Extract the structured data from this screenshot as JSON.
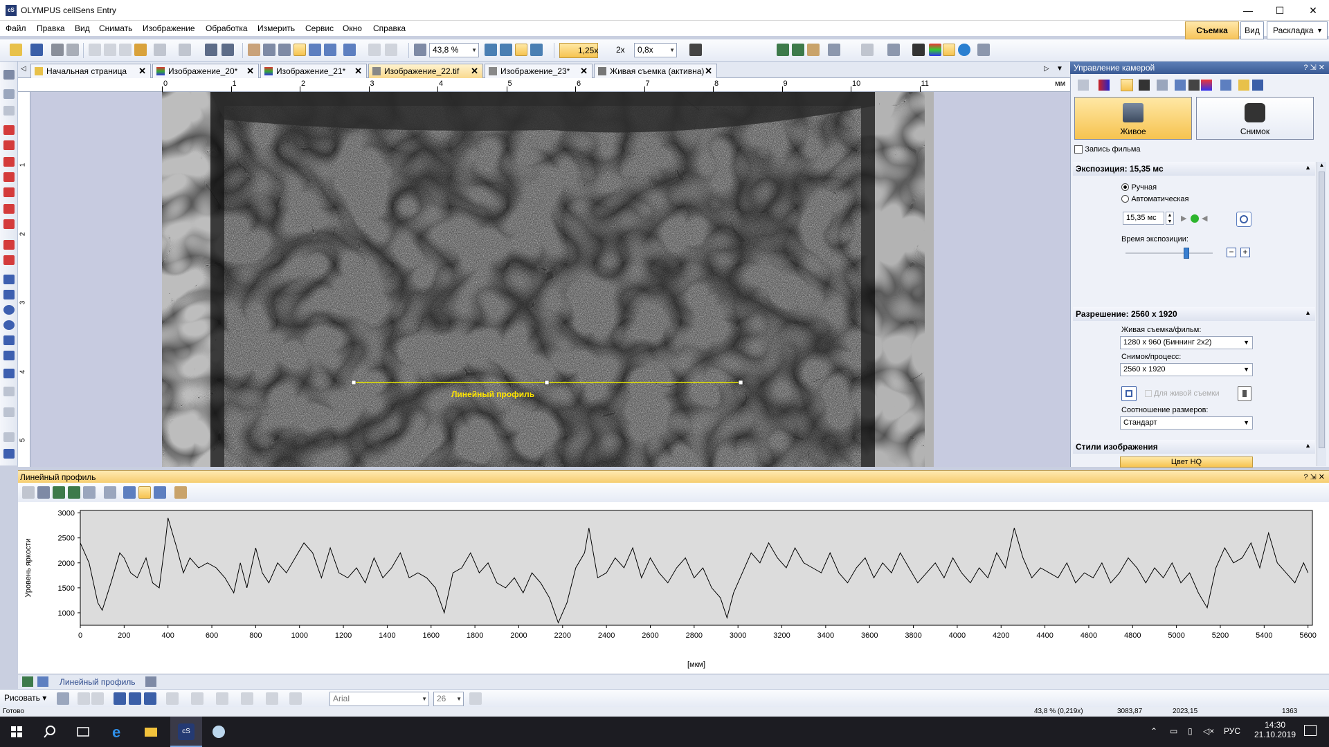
{
  "window": {
    "title": "OLYMPUS cellSens Entry",
    "min": "—",
    "max": "☐",
    "close": "✕",
    "app_icon": "cS"
  },
  "menu": [
    "Файл",
    "Правка",
    "Вид",
    "Снимать",
    "Изображение",
    "Обработка",
    "Измерить",
    "Сервис",
    "Окно",
    "Справка"
  ],
  "ribbon_tabs": {
    "capture": "Съемка",
    "view": "Вид",
    "layout": "Раскладка"
  },
  "toolbar": {
    "zoom": "43,8 %",
    "mag1": "1,25x",
    "mag2": "2x",
    "mag3": "0,8x"
  },
  "doc_tabs": [
    {
      "label": "Начальная страница",
      "active": false
    },
    {
      "label": "Изображение_20*",
      "active": false
    },
    {
      "label": "Изображение_21*",
      "active": false
    },
    {
      "label": "Изображение_22.tif",
      "active": true
    },
    {
      "label": "Изображение_23*",
      "active": false
    },
    {
      "label": "Живая съемка (активна)",
      "active": false
    }
  ],
  "ruler": {
    "unit": "мм",
    "ticks": [
      "0",
      "1",
      "2",
      "3",
      "4",
      "5",
      "6",
      "7",
      "8",
      "9",
      "10",
      "11"
    ],
    "vticks": [
      "1",
      "2",
      "3",
      "4",
      "5"
    ]
  },
  "image": {
    "profile_label": "Линейный профиль"
  },
  "camera_panel": {
    "title": "Управление камерой",
    "live_btn": "Живое",
    "snap_btn": "Снимок",
    "record_movie": "Запись фильма",
    "exposure_header": "Экспозиция: 15,35 мс",
    "mode_manual": "Ручная",
    "mode_auto": "Автоматическая",
    "exposure_value": "15,35 мс",
    "exposure_time_label": "Время экспозиции:",
    "exposure_slider_level": 0.7,
    "resolution_header": "Разрешение: 2560 x 1920",
    "live_label": "Живая съемка/фильм:",
    "live_value": "1280 x 960 (Биннинг 2x2)",
    "snap_label": "Снимок/процесс:",
    "snap_value": "2560 x 1920",
    "for_live": "Для живой съемки",
    "aspect_label": "Соотношение размеров:",
    "aspect_value": "Стандарт",
    "styles_header": "Стили изображения",
    "style_btn": "Цвет HQ"
  },
  "line_profile": {
    "title": "Линейный профиль",
    "ctrl": "? ⇲ ✕"
  },
  "chart_data": {
    "type": "line",
    "title": "",
    "xlabel": "[мкм]",
    "ylabel": "Уровень яркости",
    "xlim": [
      0,
      5620
    ],
    "ylim": [
      750,
      3050
    ],
    "x_ticks": [
      0,
      200,
      400,
      600,
      800,
      1000,
      1200,
      1400,
      1600,
      1800,
      2000,
      2200,
      2400,
      2600,
      2800,
      3000,
      3200,
      3400,
      3600,
      3800,
      4000,
      4200,
      4400,
      4600,
      4800,
      5000,
      5200,
      5400,
      5600
    ],
    "y_ticks": [
      1000,
      1500,
      2000,
      2500,
      3000
    ],
    "grid": false,
    "series": [
      {
        "values": [
          [
            0,
            2400
          ],
          [
            40,
            2000
          ],
          [
            80,
            1200
          ],
          [
            100,
            1050
          ],
          [
            140,
            1600
          ],
          [
            180,
            2200
          ],
          [
            200,
            2100
          ],
          [
            230,
            1800
          ],
          [
            260,
            1700
          ],
          [
            300,
            2100
          ],
          [
            330,
            1600
          ],
          [
            360,
            1500
          ],
          [
            390,
            2500
          ],
          [
            400,
            2900
          ],
          [
            420,
            2600
          ],
          [
            440,
            2300
          ],
          [
            470,
            1800
          ],
          [
            500,
            2100
          ],
          [
            540,
            1900
          ],
          [
            580,
            2000
          ],
          [
            620,
            1900
          ],
          [
            660,
            1700
          ],
          [
            700,
            1400
          ],
          [
            730,
            2000
          ],
          [
            760,
            1500
          ],
          [
            800,
            2300
          ],
          [
            830,
            1800
          ],
          [
            860,
            1600
          ],
          [
            900,
            2000
          ],
          [
            940,
            1800
          ],
          [
            980,
            2100
          ],
          [
            1020,
            2400
          ],
          [
            1060,
            2200
          ],
          [
            1100,
            1700
          ],
          [
            1140,
            2300
          ],
          [
            1180,
            1800
          ],
          [
            1220,
            1700
          ],
          [
            1260,
            1900
          ],
          [
            1300,
            1600
          ],
          [
            1340,
            2100
          ],
          [
            1380,
            1700
          ],
          [
            1420,
            1900
          ],
          [
            1460,
            2200
          ],
          [
            1500,
            1700
          ],
          [
            1540,
            1800
          ],
          [
            1580,
            1700
          ],
          [
            1620,
            1500
          ],
          [
            1660,
            1000
          ],
          [
            1700,
            1800
          ],
          [
            1740,
            1900
          ],
          [
            1780,
            2200
          ],
          [
            1820,
            1800
          ],
          [
            1860,
            2000
          ],
          [
            1900,
            1600
          ],
          [
            1940,
            1500
          ],
          [
            1980,
            1700
          ],
          [
            2020,
            1400
          ],
          [
            2060,
            1800
          ],
          [
            2100,
            1600
          ],
          [
            2140,
            1300
          ],
          [
            2180,
            800
          ],
          [
            2220,
            1200
          ],
          [
            2260,
            1900
          ],
          [
            2300,
            2200
          ],
          [
            2320,
            2700
          ],
          [
            2360,
            1700
          ],
          [
            2400,
            1800
          ],
          [
            2440,
            2100
          ],
          [
            2480,
            1900
          ],
          [
            2520,
            2300
          ],
          [
            2560,
            1700
          ],
          [
            2600,
            2100
          ],
          [
            2640,
            1800
          ],
          [
            2680,
            1600
          ],
          [
            2720,
            1900
          ],
          [
            2760,
            2100
          ],
          [
            2800,
            1700
          ],
          [
            2840,
            1900
          ],
          [
            2880,
            1500
          ],
          [
            2920,
            1300
          ],
          [
            2950,
            900
          ],
          [
            2980,
            1400
          ],
          [
            3020,
            1800
          ],
          [
            3060,
            2200
          ],
          [
            3100,
            2000
          ],
          [
            3140,
            2400
          ],
          [
            3180,
            2100
          ],
          [
            3220,
            1900
          ],
          [
            3260,
            2300
          ],
          [
            3300,
            2000
          ],
          [
            3340,
            1900
          ],
          [
            3380,
            1800
          ],
          [
            3420,
            2200
          ],
          [
            3460,
            1800
          ],
          [
            3500,
            1600
          ],
          [
            3540,
            1900
          ],
          [
            3580,
            2100
          ],
          [
            3620,
            1700
          ],
          [
            3660,
            2000
          ],
          [
            3700,
            1800
          ],
          [
            3740,
            2200
          ],
          [
            3780,
            1900
          ],
          [
            3820,
            1600
          ],
          [
            3860,
            1800
          ],
          [
            3900,
            2000
          ],
          [
            3940,
            1700
          ],
          [
            3980,
            2100
          ],
          [
            4020,
            1800
          ],
          [
            4060,
            1600
          ],
          [
            4100,
            1900
          ],
          [
            4140,
            1700
          ],
          [
            4180,
            2200
          ],
          [
            4220,
            1900
          ],
          [
            4260,
            2700
          ],
          [
            4300,
            2100
          ],
          [
            4340,
            1700
          ],
          [
            4380,
            1900
          ],
          [
            4420,
            1800
          ],
          [
            4460,
            1700
          ],
          [
            4500,
            2000
          ],
          [
            4540,
            1600
          ],
          [
            4580,
            1800
          ],
          [
            4620,
            1700
          ],
          [
            4660,
            2000
          ],
          [
            4700,
            1600
          ],
          [
            4740,
            1800
          ],
          [
            4780,
            2100
          ],
          [
            4820,
            1900
          ],
          [
            4860,
            1600
          ],
          [
            4900,
            1900
          ],
          [
            4940,
            1700
          ],
          [
            4980,
            2000
          ],
          [
            5020,
            1600
          ],
          [
            5060,
            1800
          ],
          [
            5100,
            1400
          ],
          [
            5140,
            1100
          ],
          [
            5180,
            1900
          ],
          [
            5220,
            2300
          ],
          [
            5260,
            2000
          ],
          [
            5300,
            2100
          ],
          [
            5340,
            2400
          ],
          [
            5380,
            1900
          ],
          [
            5420,
            2600
          ],
          [
            5460,
            2000
          ],
          [
            5500,
            1800
          ],
          [
            5540,
            1600
          ],
          [
            5580,
            2000
          ],
          [
            5600,
            1800
          ]
        ]
      }
    ]
  },
  "bottom_tab": "Линейный профиль",
  "draw_bar": {
    "draw": "Рисовать",
    "font": "Arial",
    "size": "26"
  },
  "status": {
    "ready": "Готово",
    "zoom": "43,8 % (0,219x)",
    "x": "3083,87",
    "y": "2023,15",
    "v": "1363"
  },
  "taskbar": {
    "lang": "РУС",
    "time": "14:30",
    "date": "21.10.2019"
  }
}
